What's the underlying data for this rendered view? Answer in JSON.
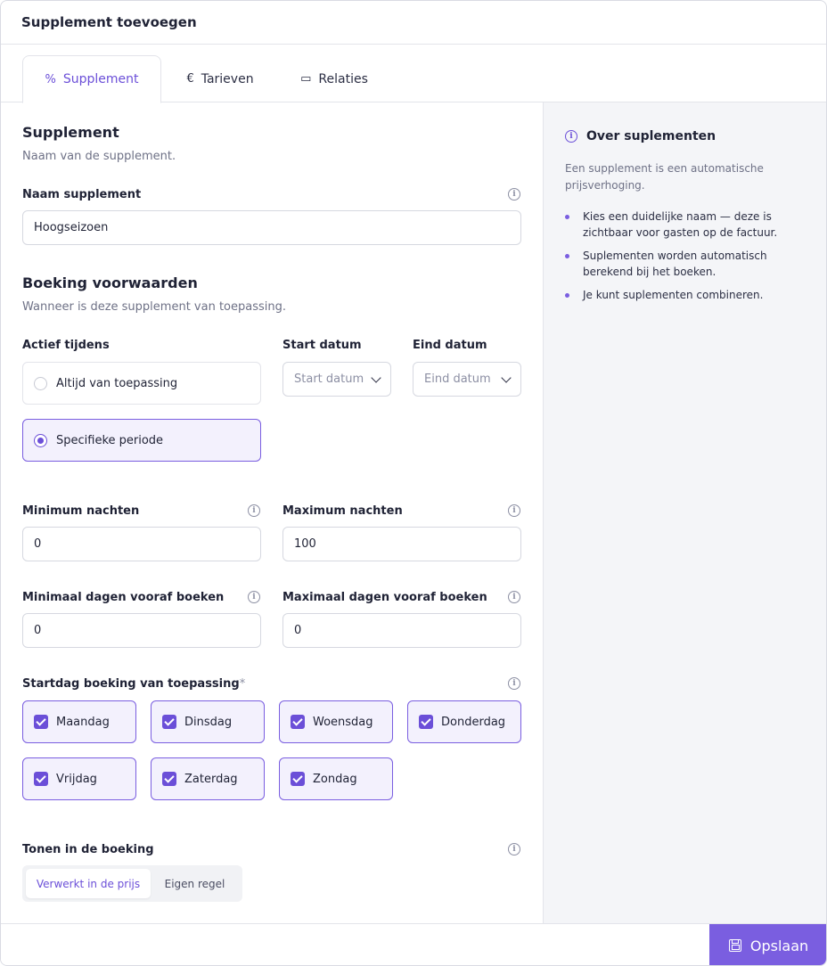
{
  "modal": {
    "title": "Supplement toevoegen"
  },
  "tabs": [
    {
      "label": "Supplement",
      "icon": "percent-icon",
      "glyph": "%"
    },
    {
      "label": "Tarieven",
      "icon": "euro-icon",
      "glyph": "€"
    },
    {
      "label": "Relaties",
      "icon": "calendar-icon",
      "glyph": "▭"
    }
  ],
  "supplement": {
    "title": "Supplement",
    "subtitle": "Naam van de supplement.",
    "name_label": "Naam supplement",
    "name_value": "Hoogseizoen"
  },
  "conditions": {
    "title": "Boeking voorwaarden",
    "subtitle": "Wanneer is deze supplement van toepassing.",
    "active_label": "Actief tijdens",
    "option_always": "Altijd van toepassing",
    "option_specific": "Specifieke periode",
    "selected_option": "Specifieke periode",
    "start_label": "Start datum",
    "start_placeholder": "Start datum",
    "end_label": "Eind datum",
    "end_placeholder": "Eind datum",
    "min_nights_label": "Minimum nachten",
    "min_nights_value": "0",
    "max_nights_label": "Maximum nachten",
    "max_nights_value": "100",
    "min_days_label": "Minimaal dagen vooraf boeken",
    "min_days_value": "0",
    "max_days_label": "Maximaal dagen vooraf boeken",
    "max_days_value": "0",
    "startday_label": "Startdag boeking van toepassing",
    "required_mark": "*",
    "days": [
      {
        "label": "Maandag",
        "checked": true
      },
      {
        "label": "Dinsdag",
        "checked": true
      },
      {
        "label": "Woensdag",
        "checked": true
      },
      {
        "label": "Donderdag",
        "checked": true
      },
      {
        "label": "Vrijdag",
        "checked": true
      },
      {
        "label": "Zaterdag",
        "checked": true
      },
      {
        "label": "Zondag",
        "checked": true
      }
    ],
    "display_label": "Tonen in de boeking",
    "display_options": [
      "Verwerkt in de prijs",
      "Eigen regel"
    ],
    "display_selected": "Verwerkt in de prijs"
  },
  "side": {
    "title": "Over suplementen",
    "intro": "Een supplement is een automatische prijsverhoging.",
    "bullets": [
      "Kies een duidelijke naam — deze is zichtbaar voor gasten op de factuur.",
      "Suplementen worden automatisch berekend bij het boeken.",
      "Je kunt suplementen combineren."
    ]
  },
  "footer": {
    "save_label": "Opslaan"
  },
  "colors": {
    "accent": "#7a5ee0",
    "accent_dark": "#6b4fd8",
    "accent_bg": "#f3f1fd"
  }
}
